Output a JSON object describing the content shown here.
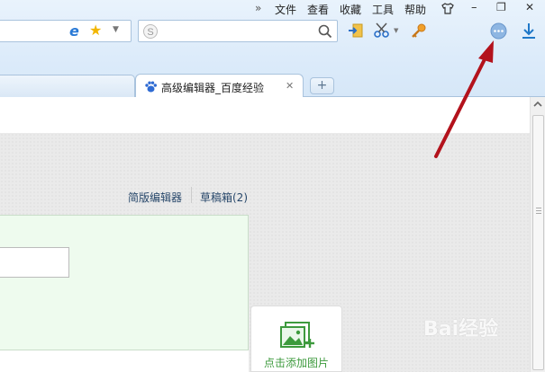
{
  "menubar": {
    "chevron": "»",
    "items": [
      "文件",
      "查看",
      "收藏",
      "工具",
      "帮助"
    ],
    "shirt_icon": "shirt-icon",
    "minimize": "–",
    "restore": "❐",
    "close": "✕"
  },
  "tab": {
    "title": "高级编辑器_百度经验",
    "close": "✕",
    "add": "+"
  },
  "page": {
    "links": [
      "简版编辑器",
      "草稿箱(2)"
    ],
    "add_image_label": "点击添加图片",
    "watermark": "Bai经验"
  },
  "colors": {
    "annotation_arrow": "#b3121c",
    "link": "#27476a",
    "green": "#3d9a3d",
    "chrome_bg": "#dcebfa"
  }
}
